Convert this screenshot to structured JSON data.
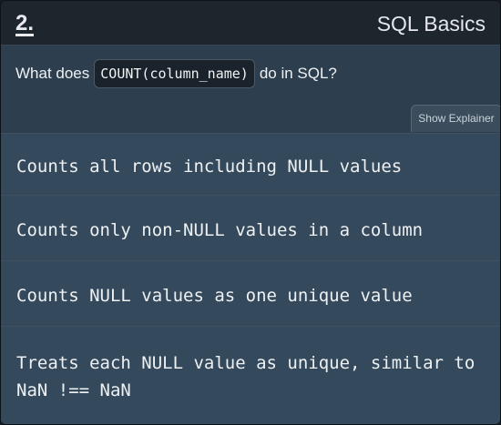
{
  "header": {
    "question_number": "2.",
    "topic": "SQL Basics"
  },
  "question": {
    "prefix": "What does",
    "code": "COUNT(column_name)",
    "suffix": "do in SQL?"
  },
  "explainer_button": {
    "label": "Show Explainer"
  },
  "options": [
    {
      "label": "Counts all rows including NULL values"
    },
    {
      "label": "Counts only non-NULL values in a column"
    },
    {
      "label": "Counts NULL values as one unique value"
    },
    {
      "label": "Treats each NULL value as unique, similar to NaN !== NaN"
    }
  ]
}
